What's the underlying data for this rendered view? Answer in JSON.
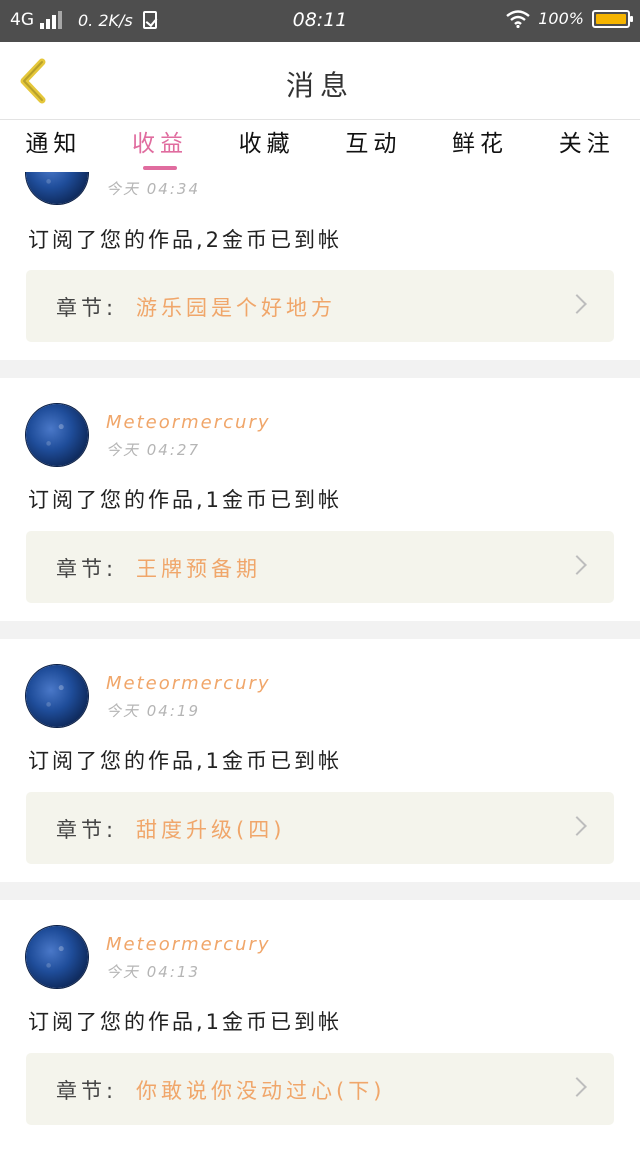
{
  "status_bar": {
    "network": "4G",
    "speed": "0. 2K/s",
    "time": "08:11",
    "battery": "100%",
    "battery_color": "#f5b400"
  },
  "header": {
    "back_icon": "chevron-left-icon",
    "title": "消息"
  },
  "tabs": [
    {
      "label": "通知",
      "active": false
    },
    {
      "label": "收益",
      "active": true
    },
    {
      "label": "收藏",
      "active": false
    },
    {
      "label": "互动",
      "active": false
    },
    {
      "label": "鲜花",
      "active": false
    },
    {
      "label": "关注",
      "active": false
    }
  ],
  "accent_color": "#e06c9f",
  "messages": [
    {
      "time": "今天 04:34",
      "text": "订阅了您的作品,2金币已到帐",
      "chapter_label": "章节:",
      "chapter_name": "游乐园是个好地方"
    },
    {
      "user": "Meteormercury",
      "time": "今天 04:27",
      "text": "订阅了您的作品,1金币已到帐",
      "chapter_label": "章节:",
      "chapter_name": "王牌预备期"
    },
    {
      "user": "Meteormercury",
      "time": "今天 04:19",
      "text": "订阅了您的作品,1金币已到帐",
      "chapter_label": "章节:",
      "chapter_name": "甜度升级(四)"
    },
    {
      "user": "Meteormercury",
      "time": "今天 04:13",
      "text": "订阅了您的作品,1金币已到帐",
      "chapter_label": "章节:",
      "chapter_name": "你敢说你没动过心(下)"
    }
  ]
}
